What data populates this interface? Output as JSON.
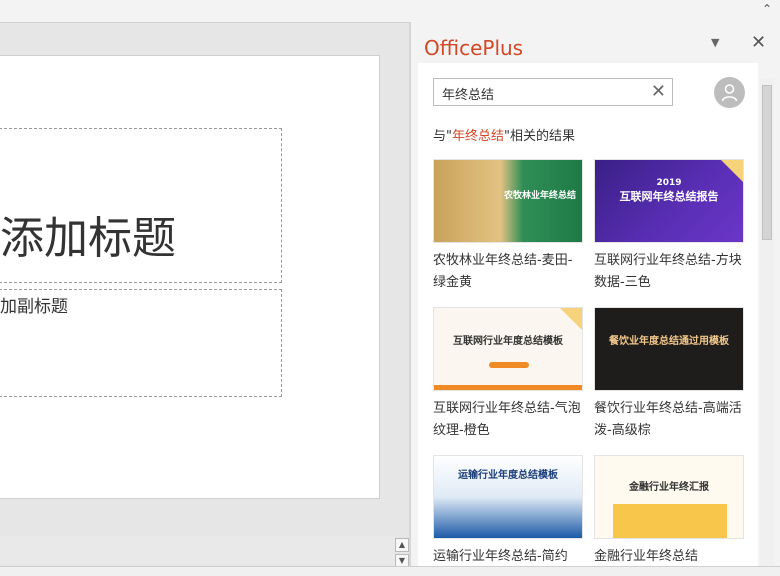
{
  "pane": {
    "title": "OfficePlus",
    "search_value": "年终总结",
    "result_prefix": "与\"",
    "result_keyword": "年终总结",
    "result_suffix": "\"相关的结果"
  },
  "slide": {
    "title_placeholder": "添加标题",
    "subtitle_placeholder": "加副标题"
  },
  "templates": [
    {
      "label": "农牧林业年终总结-麦田-绿金黄",
      "thumb_title": "农牧林业年终总结"
    },
    {
      "label": "互联网行业年终总结-方块数据-三色",
      "thumb_title": "互联网年终总结报告",
      "thumb_year": "2019"
    },
    {
      "label": "互联网行业年终总结-气泡纹理-橙色",
      "thumb_title": "互联网行业年度总结模板"
    },
    {
      "label": "餐饮行业年终总结-高端活泼-高级棕",
      "thumb_title": "餐饮业年度总结通过用模板"
    },
    {
      "label": "运输行业年终总结-简约",
      "thumb_title": "运输行业年度总结模板"
    },
    {
      "label": "金融行业年终总结",
      "thumb_title": "金融行业年终汇报"
    }
  ],
  "colors": {
    "accent": "#d24726"
  },
  "icons": {
    "clear": "x-icon",
    "close": "close-icon",
    "dropdown": "chevron-down-icon",
    "avatar": "user-icon"
  }
}
